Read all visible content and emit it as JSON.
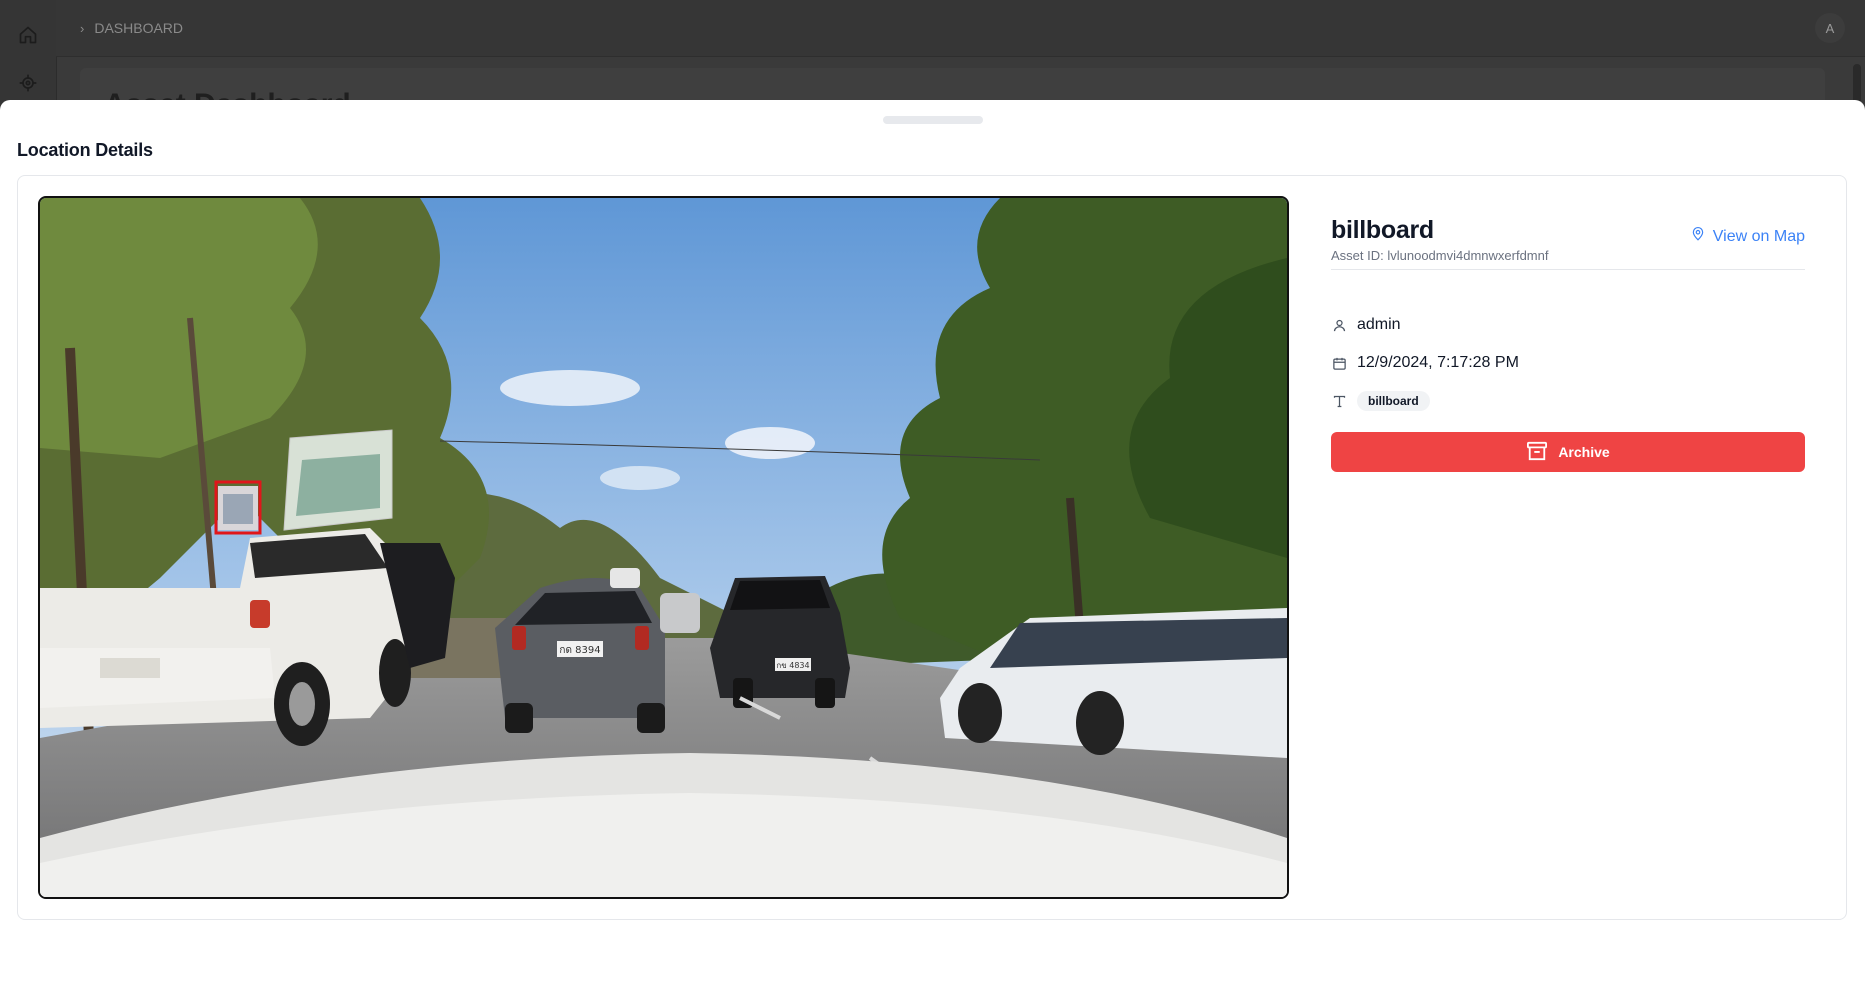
{
  "background": {
    "breadcrumb": "DASHBOARD",
    "avatar_initial": "A",
    "page_heading": "Asset Dashboard"
  },
  "sheet": {
    "title": "Location Details"
  },
  "asset": {
    "name": "billboard",
    "asset_id_label": "Asset ID: lvlunoodmvi4dmnwxerfdmnf",
    "view_on_map_label": "View on Map",
    "user": "admin",
    "timestamp": "12/9/2024, 7:17:28 PM",
    "type_tag": "billboard",
    "archive_label": "Archive"
  },
  "photo": {
    "description_scene": "street",
    "plate_left": "กด 8394",
    "plate_right": "กข 4834"
  },
  "colors": {
    "accent_blue": "#3b82f6",
    "danger_red": "#ef4444",
    "detection_box": "#e0161b"
  },
  "icons": {
    "sidebar": [
      "home-icon",
      "target-icon"
    ],
    "map_link": "map-pin-icon",
    "user": "user-icon",
    "date": "calendar-icon",
    "type": "type-icon",
    "archive": "archive-icon"
  }
}
